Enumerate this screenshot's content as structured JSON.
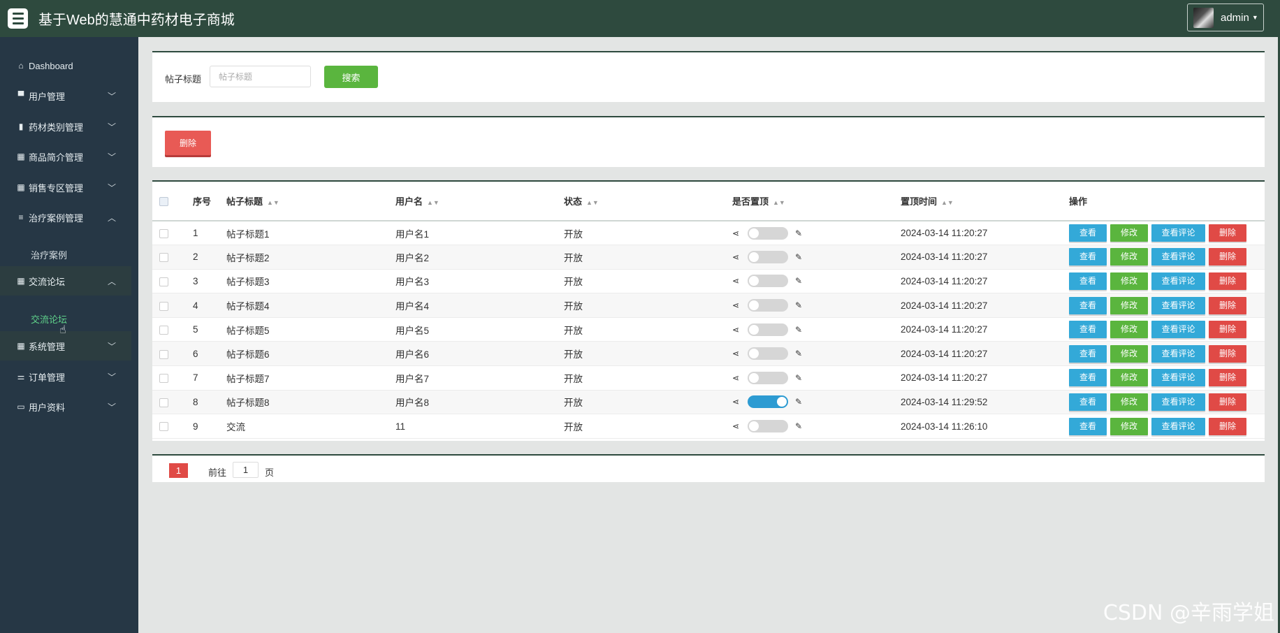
{
  "header": {
    "title": "基于Web的慧通中药材电子商城",
    "user": "admin",
    "accent": "#2e4a3e"
  },
  "sidebar": {
    "items": [
      {
        "label": "Dashboard",
        "icon": "home-icon",
        "glyph": "⌂"
      },
      {
        "label": "用户管理",
        "icon": "monitor-icon",
        "glyph": "▀"
      },
      {
        "label": "药材类别管理",
        "icon": "clipboard-icon",
        "glyph": "▮"
      },
      {
        "label": "商品简介管理",
        "icon": "grid-icon",
        "glyph": "▦"
      },
      {
        "label": "销售专区管理",
        "icon": "grid-icon",
        "glyph": "▦"
      },
      {
        "label": "治疗案例管理",
        "icon": "list-icon",
        "glyph": "≡"
      },
      {
        "label": "交流论坛",
        "icon": "grid-icon",
        "glyph": "▦"
      },
      {
        "label": "系统管理",
        "icon": "grid-icon",
        "glyph": "▦"
      },
      {
        "label": "订单管理",
        "icon": "sliders-icon",
        "glyph": "⚌"
      },
      {
        "label": "用户资料",
        "icon": "card-icon",
        "glyph": "▭"
      }
    ],
    "sub": {
      "case": "治疗案例",
      "forum": "交流论坛"
    }
  },
  "search": {
    "label": "帖子标题",
    "placeholder": "帖子标题",
    "button": "搜索"
  },
  "actions": {
    "delete": "删除"
  },
  "table": {
    "headers": {
      "seq": "序号",
      "title": "帖子标题",
      "username": "用户名",
      "status": "状态",
      "pinned": "是否置顶",
      "pinned_time": "置顶时间",
      "ops": "操作"
    },
    "op_labels": {
      "view": "查看",
      "edit": "修改",
      "comments": "查看评论",
      "delete": "删除"
    },
    "rows": [
      {
        "seq": "1",
        "title": "帖子标题1",
        "username": "用户名1",
        "status": "开放",
        "pinned": false,
        "time": "2024-03-14 11:20:27"
      },
      {
        "seq": "2",
        "title": "帖子标题2",
        "username": "用户名2",
        "status": "开放",
        "pinned": false,
        "time": "2024-03-14 11:20:27"
      },
      {
        "seq": "3",
        "title": "帖子标题3",
        "username": "用户名3",
        "status": "开放",
        "pinned": false,
        "time": "2024-03-14 11:20:27"
      },
      {
        "seq": "4",
        "title": "帖子标题4",
        "username": "用户名4",
        "status": "开放",
        "pinned": false,
        "time": "2024-03-14 11:20:27"
      },
      {
        "seq": "5",
        "title": "帖子标题5",
        "username": "用户名5",
        "status": "开放",
        "pinned": false,
        "time": "2024-03-14 11:20:27"
      },
      {
        "seq": "6",
        "title": "帖子标题6",
        "username": "用户名6",
        "status": "开放",
        "pinned": false,
        "time": "2024-03-14 11:20:27"
      },
      {
        "seq": "7",
        "title": "帖子标题7",
        "username": "用户名7",
        "status": "开放",
        "pinned": false,
        "time": "2024-03-14 11:20:27"
      },
      {
        "seq": "8",
        "title": "帖子标题8",
        "username": "用户名8",
        "status": "开放",
        "pinned": true,
        "time": "2024-03-14 11:29:52"
      },
      {
        "seq": "9",
        "title": "交流",
        "username": "11",
        "status": "开放",
        "pinned": false,
        "time": "2024-03-14 11:26:10"
      }
    ]
  },
  "pager": {
    "current": "1",
    "goto_label": "前往",
    "goto_value": "1",
    "page_label": "页"
  },
  "watermark": "CSDN @辛雨学姐"
}
